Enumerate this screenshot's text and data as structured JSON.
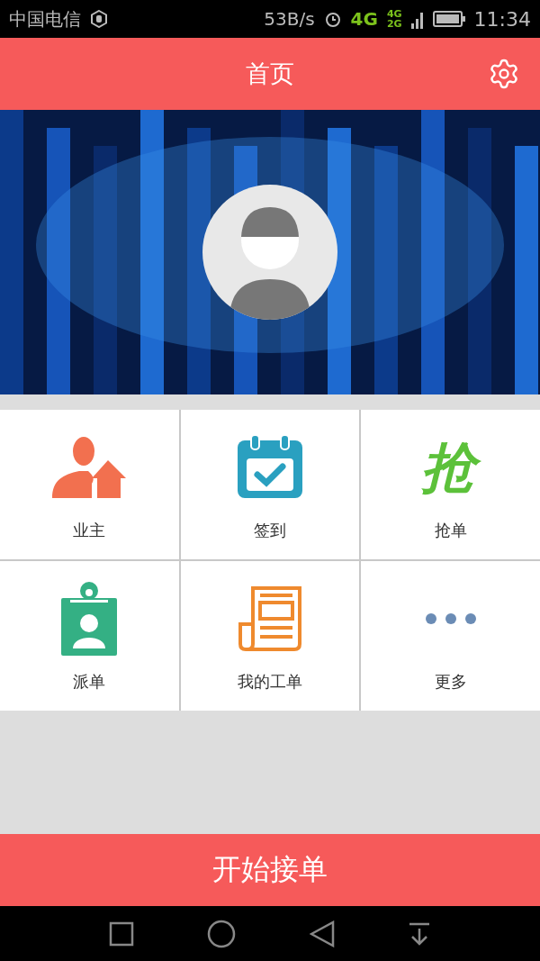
{
  "status_bar": {
    "carrier": "中国电信",
    "speed": "53B/s",
    "network_primary": "4G",
    "network_secondary_top": "4G",
    "network_secondary_bottom": "2G",
    "time": "11:34"
  },
  "header": {
    "title": "首页"
  },
  "grid": [
    {
      "kind": "owner",
      "label": "业主"
    },
    {
      "kind": "checkin",
      "label": "签到"
    },
    {
      "kind": "grab",
      "label": "抢单",
      "glyph": "抢"
    },
    {
      "kind": "dispatch",
      "label": "派单"
    },
    {
      "kind": "orders",
      "label": "我的工单"
    },
    {
      "kind": "more",
      "label": "更多"
    }
  ],
  "action_button": {
    "label": "开始接单"
  }
}
